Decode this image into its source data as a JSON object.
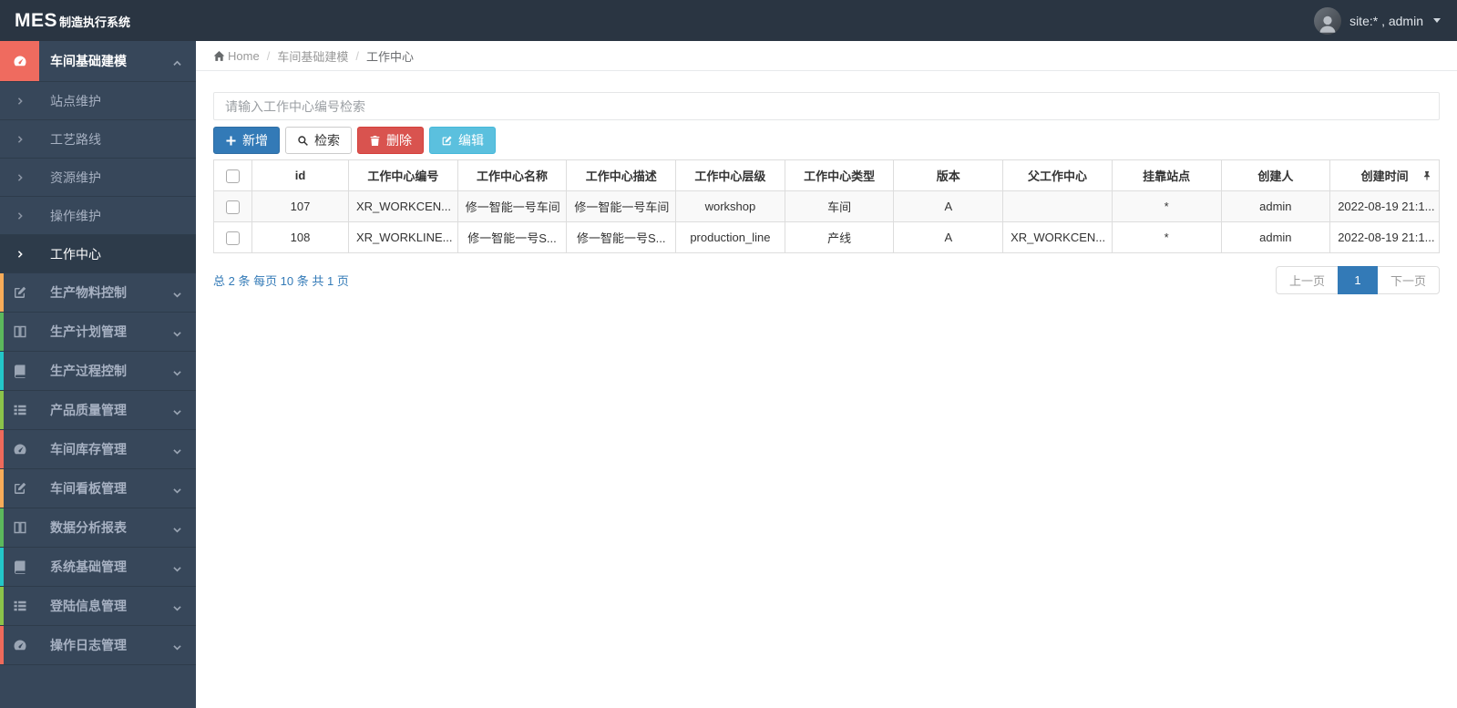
{
  "navbar": {
    "logo_primary": "MES",
    "logo_secondary": "制造执行系统",
    "user_label": "site:* , admin"
  },
  "breadcrumb": {
    "home": "Home",
    "section": "车间基础建模",
    "page": "工作中心"
  },
  "sidebar": {
    "parent_active": {
      "label": "车间基础建模"
    },
    "submenu": [
      {
        "label": "站点维护"
      },
      {
        "label": "工艺路线"
      },
      {
        "label": "资源维护"
      },
      {
        "label": "操作维护"
      },
      {
        "label": "工作中心"
      }
    ],
    "items": [
      {
        "label": "生产物料控制",
        "accent": "#f8ac59"
      },
      {
        "label": "生产计划管理",
        "accent": "#5cb85c"
      },
      {
        "label": "生产过程控制",
        "accent": "#23c6c8"
      },
      {
        "label": "产品质量管理",
        "accent": "#8bc34a"
      },
      {
        "label": "车间库存管理",
        "accent": "#ee6a5b"
      },
      {
        "label": "车间看板管理",
        "accent": "#f8ac59"
      },
      {
        "label": "数据分析报表",
        "accent": "#5cb85c"
      },
      {
        "label": "系统基础管理",
        "accent": "#23c6c8"
      },
      {
        "label": "登陆信息管理",
        "accent": "#8bc34a"
      },
      {
        "label": "操作日志管理",
        "accent": "#ee6a5b"
      }
    ]
  },
  "toolbar": {
    "search_placeholder": "请输入工作中心编号检索",
    "add_label": "新增",
    "search_label": "检索",
    "delete_label": "删除",
    "edit_label": "编辑"
  },
  "table": {
    "columns": [
      "id",
      "工作中心编号",
      "工作中心名称",
      "工作中心描述",
      "工作中心层级",
      "工作中心类型",
      "版本",
      "父工作中心",
      "挂靠站点",
      "创建人",
      "创建时间"
    ],
    "rows": [
      [
        "107",
        "XR_WORKCEN...",
        "修一智能一号车间",
        "修一智能一号车间",
        "workshop",
        "车间",
        "A",
        "",
        "*",
        "admin",
        "2022-08-19 21:1..."
      ],
      [
        "108",
        "XR_WORKLINE...",
        "修一智能一号S...",
        "修一智能一号S...",
        "production_line",
        "产线",
        "A",
        "XR_WORKCEN...",
        "*",
        "admin",
        "2022-08-19 21:1..."
      ]
    ]
  },
  "pagination": {
    "summary": "总 2 条 每页 10 条 共 1 页",
    "prev": "上一页",
    "current": "1",
    "next": "下一页"
  },
  "theme": {
    "accent_red": "#ef6b5f",
    "primary": "#337ab7",
    "danger": "#d9534f",
    "info": "#5bc0de"
  }
}
